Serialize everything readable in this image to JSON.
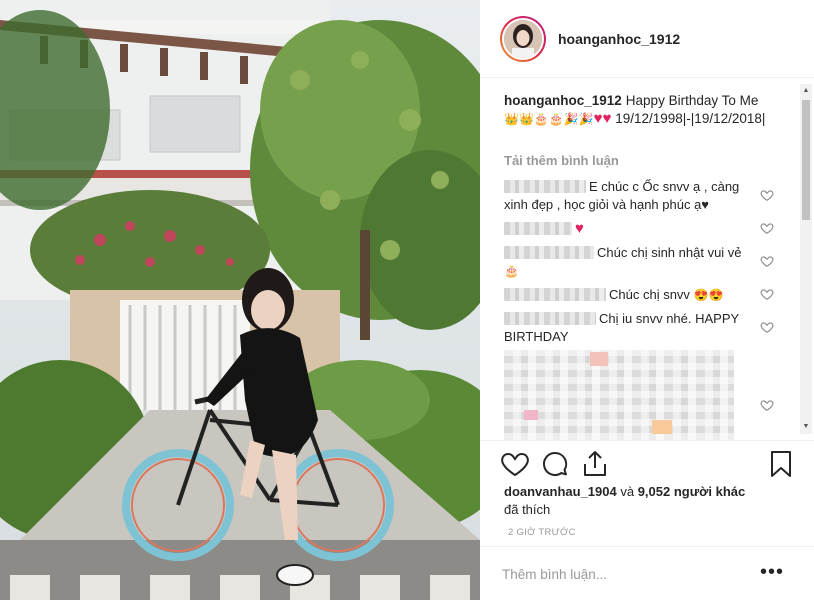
{
  "post": {
    "username": "hoanganhoc_1912",
    "caption_text": "Happy Birthday To Me",
    "caption_dates": "19/12/1998|-|19/12/2018|",
    "load_more": "Tải thêm bình luận"
  },
  "comments": [
    {
      "text": "E chúc c Ốc snvv ạ , càng xinh đẹp , học giỏi và hạnh phúc ạ♥"
    },
    {
      "text": ""
    },
    {
      "text": "Chúc chị sinh nhật vui vẻ"
    },
    {
      "text": "Chúc chị snvv"
    },
    {
      "text": "Chị iu snvv nhé. HAPPY BIRTHDAY"
    }
  ],
  "likes": {
    "user": "doanvanhau_1904",
    "connector": "và",
    "count": "9,052 người khác",
    "suffix": "đã thích"
  },
  "timestamp": "2 GIỜ TRƯỚC",
  "add_comment_placeholder": "Thêm bình luận...",
  "icons": {
    "like": "heart-outline-icon",
    "comment": "speech-bubble-icon",
    "share": "share-upload-icon",
    "save": "bookmark-icon",
    "more": "more-horizontal-icon"
  },
  "colors": {
    "heart_red": "#e0245e",
    "muted_text": "#999999",
    "text": "#262626"
  }
}
